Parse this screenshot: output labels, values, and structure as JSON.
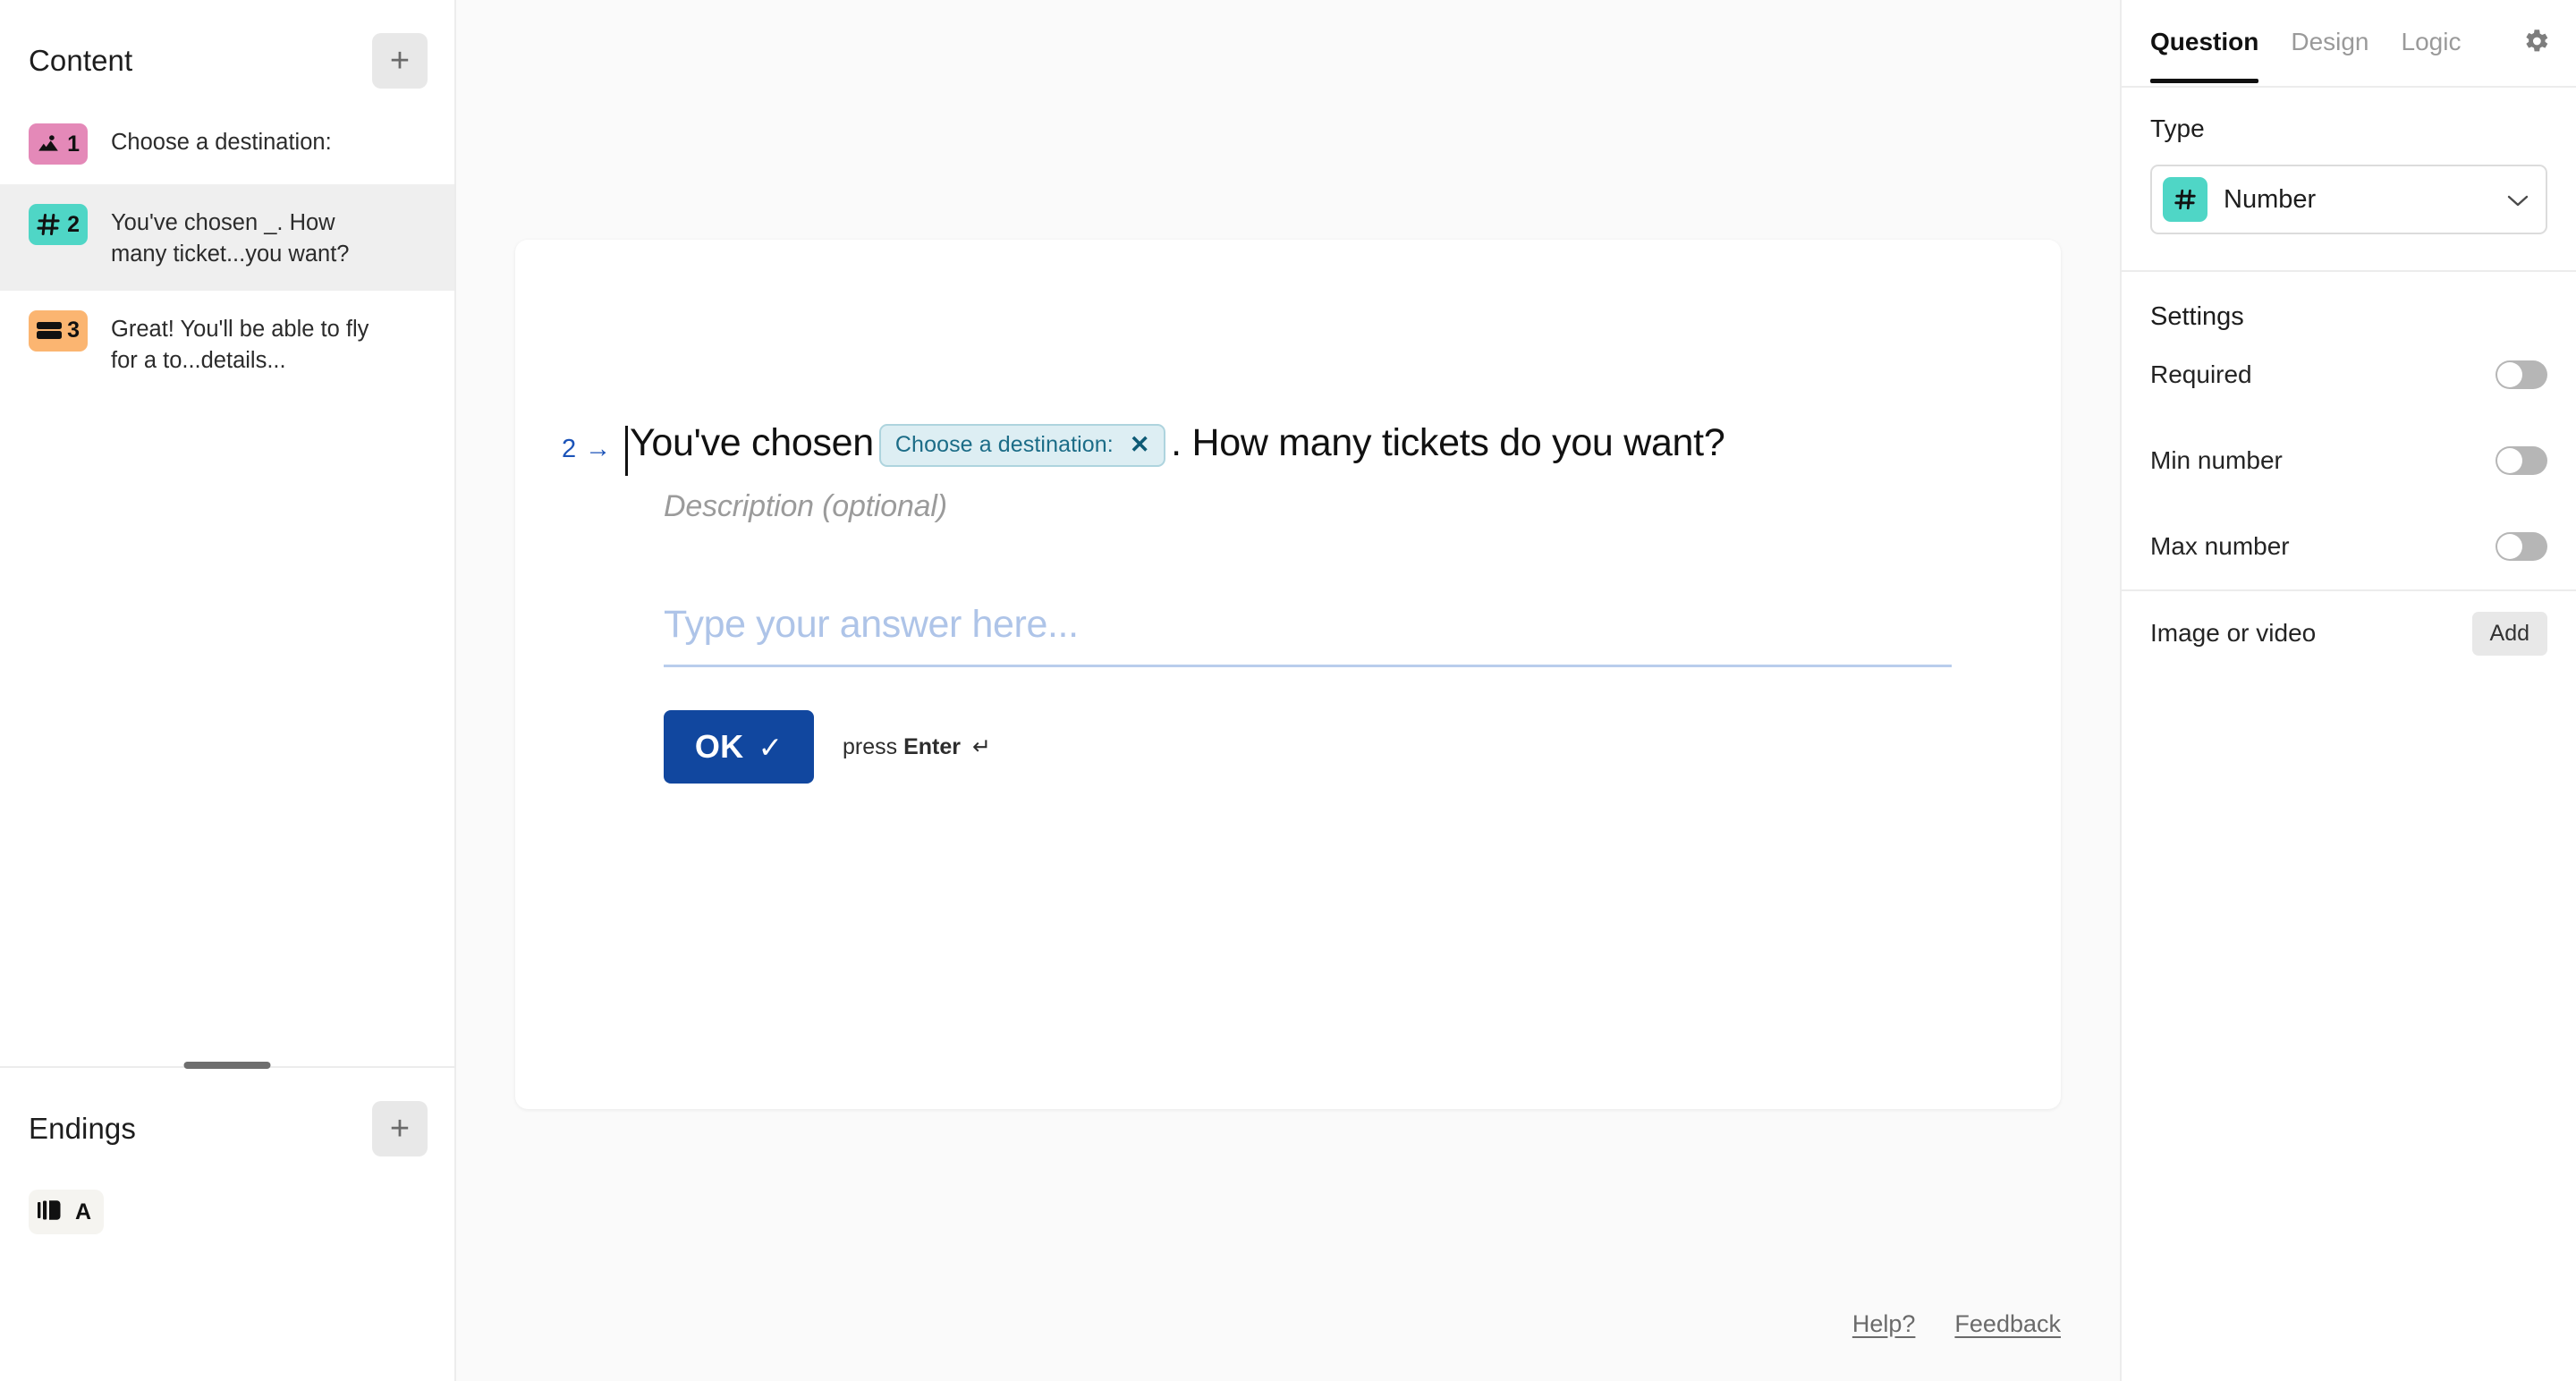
{
  "sidebar": {
    "content": {
      "title": "Content",
      "add_label": "+",
      "items": [
        {
          "number": "1",
          "label": "Choose a destination:",
          "icon": "image-icon",
          "color": "#e489b8",
          "selected": false
        },
        {
          "number": "2",
          "label": "You've chosen _. How many ticket...you want?",
          "icon": "hash-icon",
          "color": "#4fd6c6",
          "selected": true
        },
        {
          "number": "3",
          "label": "Great! You'll be able to fly for a to...details...",
          "icon": "payment-card-icon",
          "color": "#fbb571",
          "selected": false
        }
      ]
    },
    "endings": {
      "title": "Endings",
      "add_label": "+",
      "items": [
        {
          "letter": "A",
          "icon": "ending-flag-icon"
        }
      ]
    }
  },
  "canvas": {
    "question": {
      "marker": "2 →",
      "text_before": "You've chosen",
      "recall_pill": {
        "label": "Choose a destination:",
        "remove_label": "✕"
      },
      "text_after": ". How many tickets do you want?",
      "description_placeholder": "Description (optional)"
    },
    "answer": {
      "placeholder": "Type your answer here...",
      "value": ""
    },
    "submit": {
      "label": "OK",
      "check": "✓",
      "hint_prefix": "press",
      "hint_key": "Enter",
      "hint_return": "↵"
    }
  },
  "footer": {
    "help_label": "Help?",
    "feedback_label": "Feedback"
  },
  "right_panel": {
    "tabs": [
      {
        "label": "Question",
        "active": true
      },
      {
        "label": "Design",
        "active": false
      },
      {
        "label": "Logic",
        "active": false
      }
    ],
    "gear_icon": "gear-icon",
    "type": {
      "label": "Type",
      "selected": "Number",
      "icon": "hash-icon",
      "icon_color": "#4fd6c6",
      "chevron": "⌄"
    },
    "settings": {
      "title": "Settings",
      "rows": [
        {
          "label": "Required",
          "enabled": false
        },
        {
          "label": "Min number",
          "enabled": false
        },
        {
          "label": "Max number",
          "enabled": false
        }
      ]
    },
    "media": {
      "label": "Image or video",
      "add_label": "Add"
    }
  },
  "colors": {
    "accent_blue": "#11479f",
    "marker_blue": "#1b53b8",
    "pill_bg": "#ddeef3",
    "pill_text": "#1b6c87",
    "canvas_bg": "#fafafa"
  }
}
